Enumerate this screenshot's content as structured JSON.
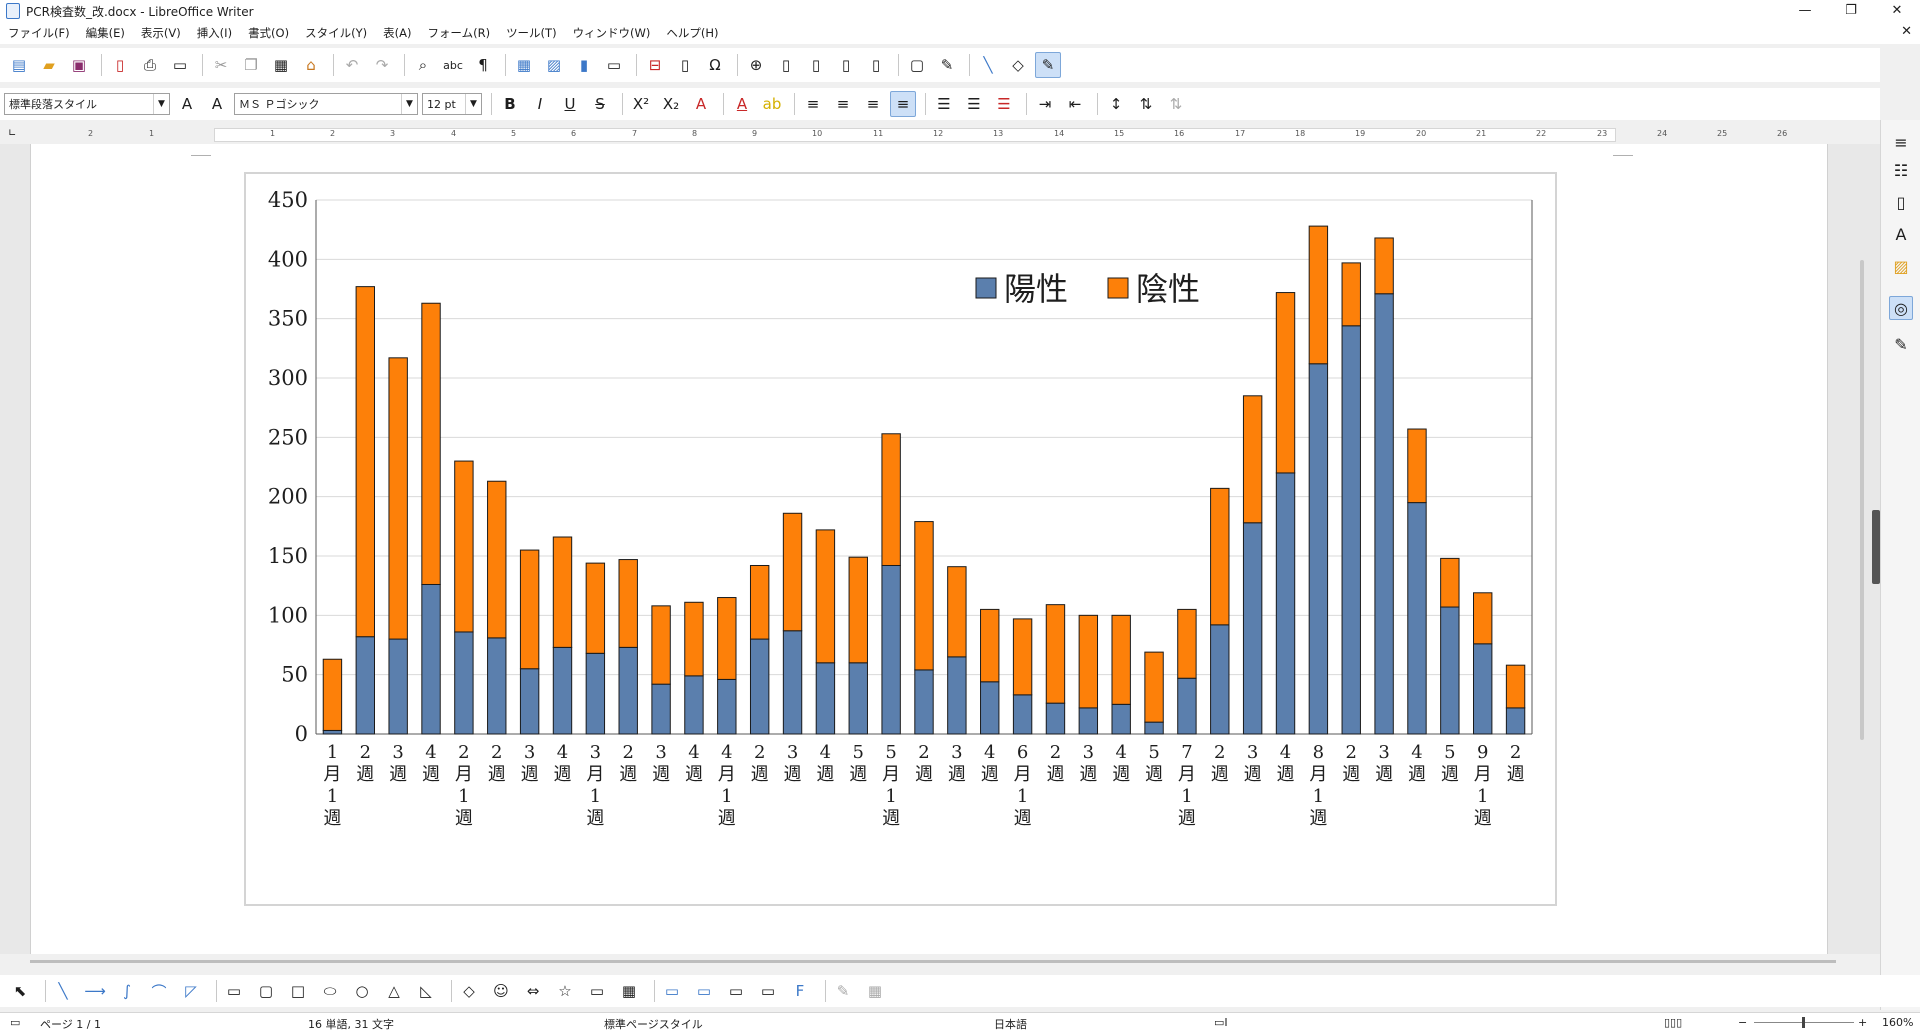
{
  "window": {
    "title": "PCR検査数_改.docx - LibreOffice Writer"
  },
  "menu": [
    "ファイル(F)",
    "編集(E)",
    "表示(V)",
    "挿入(I)",
    "書式(O)",
    "スタイル(Y)",
    "表(A)",
    "フォーム(R)",
    "ツール(T)",
    "ウィンドウ(W)",
    "ヘルプ(H)"
  ],
  "format": {
    "paragraph_style": "標準段落スタイル",
    "font_name": "ＭＳ Ｐゴシック",
    "font_size": "12 pt"
  },
  "ruler": [
    "1",
    "2",
    "1",
    "2",
    "3",
    "4",
    "5",
    "6",
    "7",
    "8",
    "9",
    "10",
    "11",
    "12",
    "13",
    "14",
    "15",
    "16",
    "17",
    "18",
    "19",
    "20",
    "21",
    "22",
    "23",
    "24",
    "25",
    "26"
  ],
  "status": {
    "page": "ページ 1 / 1",
    "words": "16 単語, 31 文字",
    "page_style": "標準ページスタイル",
    "language": "日本語",
    "zoom": "160%"
  },
  "colors": {
    "positive": "#5b7fad",
    "negative": "#fd8009",
    "selection": "#cde0f7"
  },
  "chart_data": {
    "type": "bar",
    "stacked": true,
    "ylim": [
      0,
      450
    ],
    "yticks": [
      0,
      50,
      100,
      150,
      200,
      250,
      300,
      350,
      400,
      450
    ],
    "categories": [
      "1月1週",
      "2週",
      "3週",
      "4週",
      "2月1週",
      "2週",
      "3週",
      "4週",
      "3月1週",
      "2週",
      "3週",
      "4週",
      "4月1週",
      "2週",
      "3週",
      "4週",
      "5週",
      "5月1週",
      "2週",
      "3週",
      "4週",
      "6月1週",
      "2週",
      "3週",
      "4週",
      "5週",
      "7月1週",
      "2週",
      "3週",
      "4週",
      "8月1週",
      "2週",
      "3週",
      "4週",
      "5週",
      "9月1週",
      "2週"
    ],
    "series": [
      {
        "name": "陽性",
        "values": [
          3,
          82,
          80,
          126,
          86,
          81,
          55,
          73,
          68,
          73,
          42,
          49,
          46,
          80,
          87,
          60,
          60,
          142,
          54,
          65,
          44,
          33,
          26,
          22,
          25,
          10,
          47,
          92,
          178,
          220,
          312,
          344,
          371,
          195,
          107,
          76,
          22
        ]
      },
      {
        "name": "陰性",
        "values": [
          60,
          295,
          237,
          237,
          144,
          132,
          100,
          93,
          76,
          74,
          66,
          62,
          69,
          62,
          99,
          112,
          89,
          111,
          125,
          76,
          61,
          64,
          83,
          78,
          75,
          59,
          58,
          115,
          107,
          152,
          116,
          53,
          47,
          62,
          41,
          43,
          36
        ]
      }
    ],
    "legend": "top-right",
    "grid": true
  }
}
